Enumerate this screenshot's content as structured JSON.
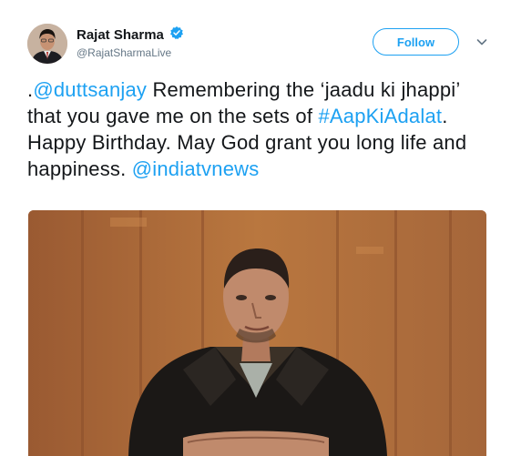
{
  "author": {
    "name": "Rajat Sharma",
    "handle": "@RajatSharmaLive",
    "verified": true,
    "avatar_icon": "profile-avatar"
  },
  "header": {
    "follow_label": "Follow",
    "menu_icon": "chevron-down-icon"
  },
  "tweet": {
    "prefix": ".",
    "mention1": "@duttsanjay",
    "text1": " Remembering the ‘jaadu ki jhappi’ that you gave me on the sets of ",
    "hashtag": "#AapKiAdalat",
    "text2": ". Happy Birthday. May God grant you long life and happiness. ",
    "mention2": "@indiatvnews"
  },
  "media": {
    "type": "photo",
    "icon": "photo-of-man-in-leather-jacket"
  },
  "colors": {
    "link": "#1da1f2",
    "text": "#14171a",
    "muted": "#657786",
    "verified_badge": "#1da1f2"
  }
}
